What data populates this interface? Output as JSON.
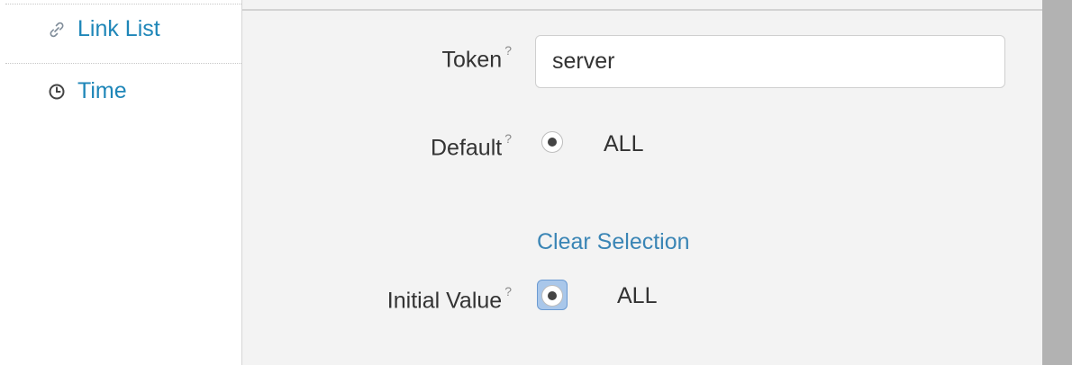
{
  "sidebar": {
    "items": [
      {
        "label": "Link List",
        "icon": "link-icon"
      },
      {
        "label": "Time",
        "icon": "clock-icon"
      }
    ]
  },
  "form": {
    "token": {
      "label": "Token",
      "help": "?",
      "value": "server"
    },
    "default": {
      "label": "Default",
      "help": "?",
      "option": "ALL",
      "selected": true
    },
    "clear_selection": "Clear Selection",
    "initial_value": {
      "label": "Initial Value",
      "help": "?",
      "option": "ALL",
      "selected": true
    }
  },
  "colors": {
    "link": "#1e86b8",
    "panel_bg": "#f3f3f3",
    "scrollbar": "#b2b2b2",
    "focus": "#a9c7ea"
  }
}
